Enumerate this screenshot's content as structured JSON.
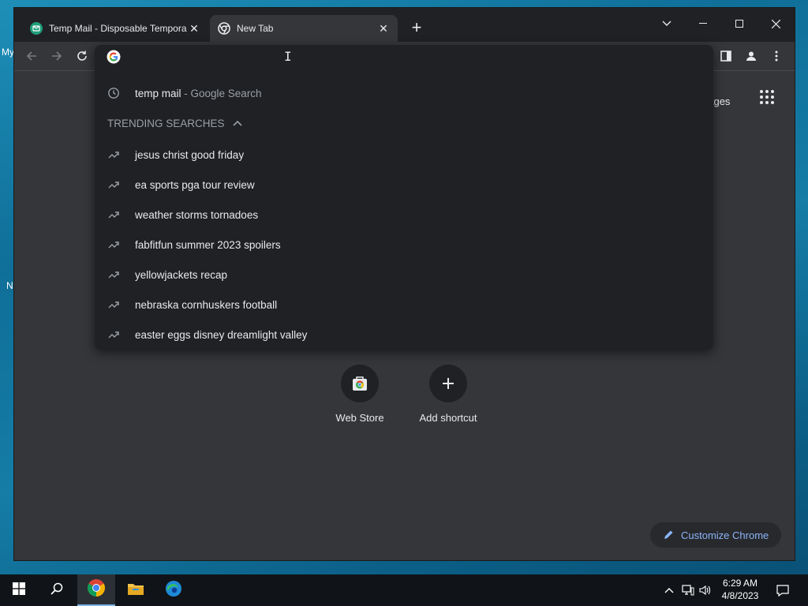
{
  "desktop": {
    "fragments": [
      "My",
      "N"
    ]
  },
  "tabs": [
    {
      "title": "Temp Mail - Disposable Tempora",
      "favicon": "tempmail-icon",
      "active": false
    },
    {
      "title": "New Tab",
      "favicon": "chrome-icon",
      "active": true
    }
  ],
  "omnibox": {
    "value": "",
    "history_suggestion": {
      "query": "temp mail",
      "suffix": " - Google Search"
    },
    "trending_header": "TRENDING SEARCHES",
    "trending": [
      "jesus christ good friday",
      "ea sports pga tour review",
      "weather storms tornadoes",
      "fabfitfun summer 2023 spoilers",
      "yellowjackets recap",
      "nebraska cornhuskers football",
      "easter eggs disney dreamlight valley"
    ]
  },
  "ntp": {
    "images_link": "nages",
    "shortcuts": [
      {
        "label": "Web Store",
        "icon": "web-store-icon"
      },
      {
        "label": "Add shortcut",
        "icon": "plus-icon"
      }
    ],
    "customize_label": "Customize Chrome"
  },
  "taskbar": {
    "time": "6:29 AM",
    "date": "4/8/2023"
  },
  "colors": {
    "accent": "#8ab4f8",
    "surface": "#35363a",
    "dropdown": "#202124"
  }
}
